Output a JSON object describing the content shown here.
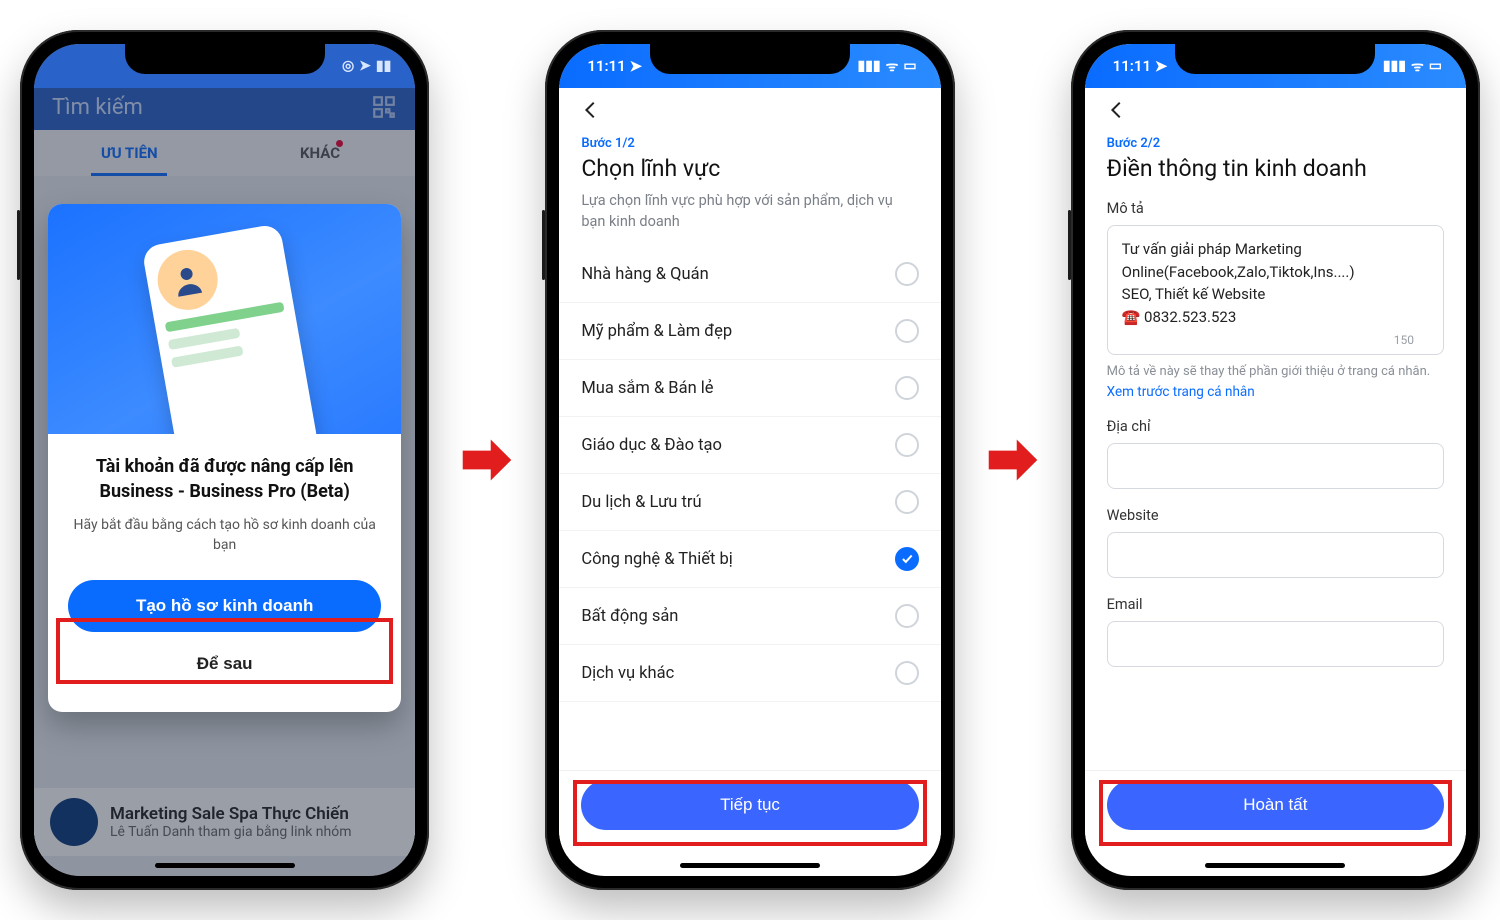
{
  "phone1": {
    "status": {
      "time_hidden": true,
      "icons": "◎ ➤ ▬"
    },
    "header": {
      "search_placeholder": "Tìm kiếm"
    },
    "tabs": {
      "active": "ƯU TIÊN",
      "inactive": "KHÁC"
    },
    "modal": {
      "title": "Tài khoản đã được nâng cấp lên Business - Business Pro (Beta)",
      "subtitle": "Hãy bắt đầu bằng cách tạo hồ sơ kinh doanh của bạn",
      "primary_btn": "Tạo hồ sơ kinh doanh",
      "secondary_btn": "Để sau"
    },
    "chat_row": {
      "title": "Marketing Sale Spa Thực Chiến",
      "subtitle": "Lê Tuấn Danh tham gia bằng link nhóm"
    }
  },
  "phone2": {
    "status_time": "11:11",
    "step_label": "Bước 1/2",
    "heading": "Chọn lĩnh vực",
    "subtext": "Lựa chọn lĩnh vực phù hợp với sản phẩm, dịch vụ bạn kinh doanh",
    "categories": [
      {
        "label": "Nhà hàng & Quán",
        "selected": false
      },
      {
        "label": "Mỹ phẩm & Làm đẹp",
        "selected": false
      },
      {
        "label": "Mua sắm & Bán lẻ",
        "selected": false
      },
      {
        "label": "Giáo dục & Đào tạo",
        "selected": false
      },
      {
        "label": "Du lịch & Lưu trú",
        "selected": false
      },
      {
        "label": "Công nghệ & Thiết bị",
        "selected": true
      },
      {
        "label": "Bất động sản",
        "selected": false
      },
      {
        "label": "Dịch vụ khác",
        "selected": false
      }
    ],
    "continue_btn": "Tiếp tục"
  },
  "phone3": {
    "status_time": "11:11",
    "step_label": "Bước 2/2",
    "heading": "Điền thông tin kinh doanh",
    "desc_label": "Mô tả",
    "desc_value": "Tư vấn giải pháp Marketing Online(Facebook,Zalo,Tiktok,Ins....)\nSEO, Thiết kế Website\n☎️ 0832.523.523",
    "desc_count": "150",
    "desc_hint": "Mô tả về này sẽ thay thế phần giới thiệu ở trang cá nhân.",
    "preview_link": "Xem trước trang cá nhân",
    "address_label": "Địa chỉ",
    "address_value": "",
    "website_label": "Website",
    "website_value": "",
    "email_label": "Email",
    "email_value": "",
    "finish_btn": "Hoàn tất"
  }
}
